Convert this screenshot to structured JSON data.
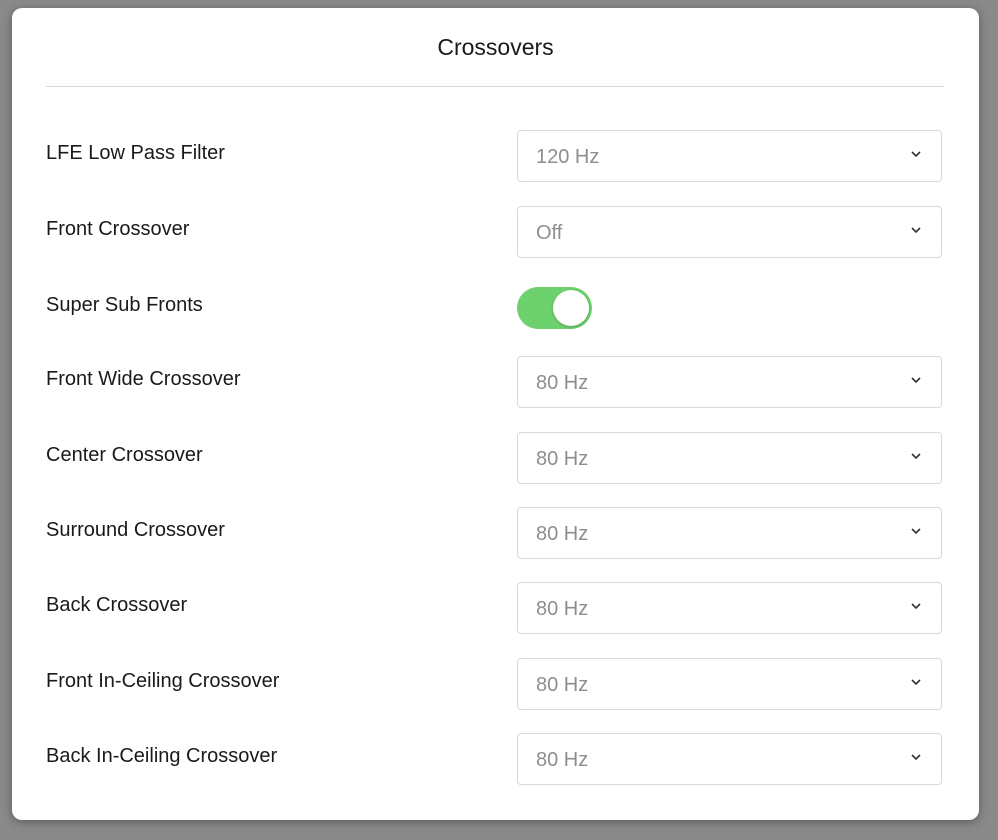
{
  "title": "Crossovers",
  "colors": {
    "toggle_on": "#6dd26d",
    "value_text": "#8e8e8e"
  },
  "settings": [
    {
      "label": "LFE Low Pass Filter",
      "type": "select",
      "value": "120 Hz"
    },
    {
      "label": "Front Crossover",
      "type": "select",
      "value": "Off"
    },
    {
      "label": "Super Sub Fronts",
      "type": "toggle",
      "value": "on"
    },
    {
      "label": "Front Wide Crossover",
      "type": "select",
      "value": "80 Hz"
    },
    {
      "label": "Center Crossover",
      "type": "select",
      "value": "80 Hz"
    },
    {
      "label": "Surround Crossover",
      "type": "select",
      "value": "80 Hz"
    },
    {
      "label": "Back Crossover",
      "type": "select",
      "value": "80 Hz"
    },
    {
      "label": "Front In-Ceiling Crossover",
      "type": "select",
      "value": "80 Hz"
    },
    {
      "label": "Back In-Ceiling Crossover",
      "type": "select",
      "value": "80 Hz"
    }
  ]
}
